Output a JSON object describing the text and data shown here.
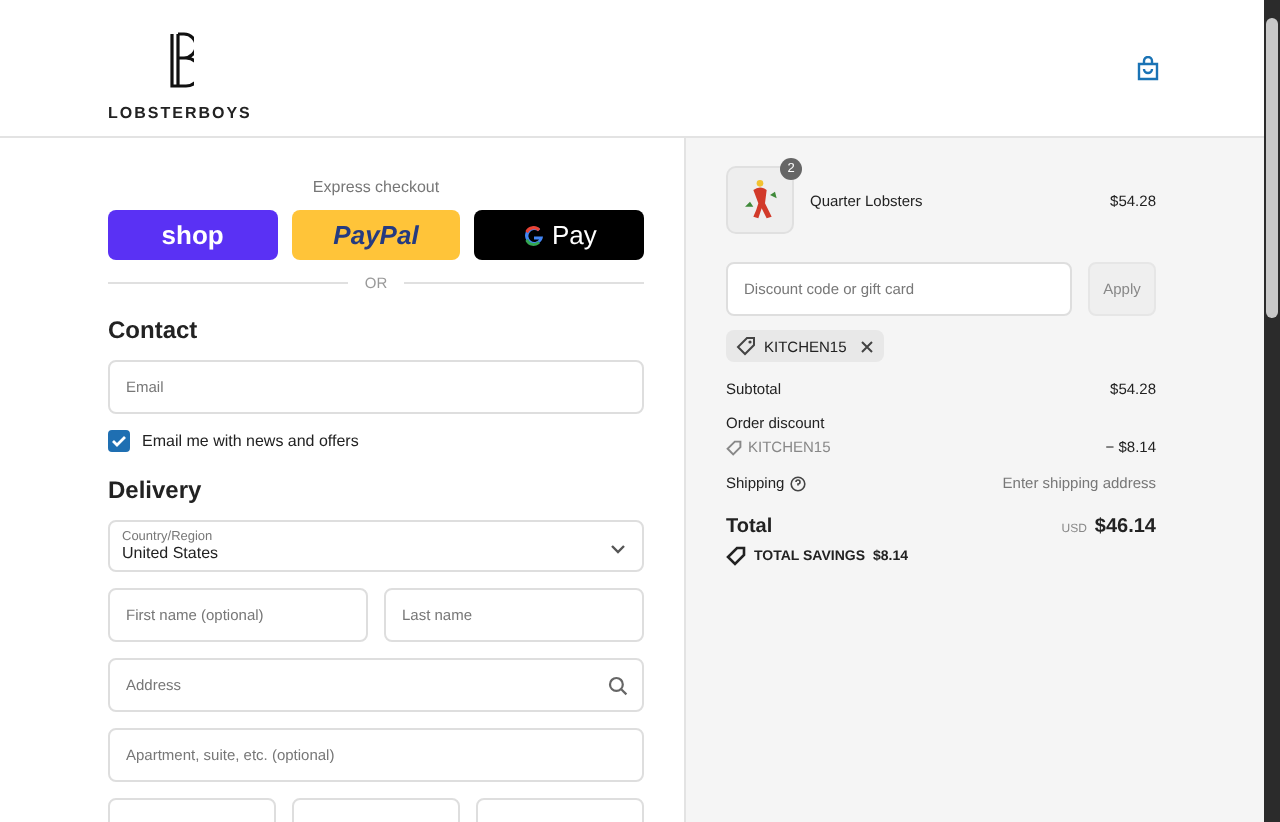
{
  "header": {
    "brand": "LOBSTERBOYS"
  },
  "express": {
    "title": "Express checkout",
    "buttons": [
      {
        "kind": "shop",
        "label": "shop"
      },
      {
        "kind": "paypal",
        "label": "PayPal"
      },
      {
        "kind": "gpay",
        "label": "Pay"
      }
    ],
    "divider": "OR"
  },
  "contact": {
    "title": "Contact",
    "email_placeholder": "Email",
    "newsletter": {
      "label": "Email me with news and offers",
      "checked": true
    }
  },
  "delivery": {
    "title": "Delivery",
    "country": {
      "label": "Country/Region",
      "value": "United States"
    },
    "fields": [
      {
        "kind": "half",
        "placeholder": "First name (optional)"
      },
      {
        "kind": "half",
        "placeholder": "Last name"
      },
      {
        "kind": "search",
        "placeholder": "Address"
      },
      {
        "kind": "full",
        "placeholder": "Apartment, suite, etc. (optional)"
      }
    ]
  },
  "summary": {
    "item": {
      "name": "Quarter Lobsters",
      "quantity": "2",
      "price": "$54.28"
    },
    "discount": {
      "placeholder": "Discount code or gift card",
      "button": "Apply",
      "applied": "KITCHEN15"
    },
    "subtotal": {
      "label": "Subtotal",
      "value": "$54.28"
    },
    "order_discount": {
      "label": "Order discount",
      "code": "KITCHEN15",
      "value": "− $8.14"
    },
    "shipping": {
      "label": "Shipping",
      "value": "Enter shipping address"
    },
    "total": {
      "label": "Total",
      "currency": "USD",
      "value": "$46.14"
    },
    "savings": {
      "label": "TOTAL SAVINGS",
      "value": "$8.14"
    }
  }
}
